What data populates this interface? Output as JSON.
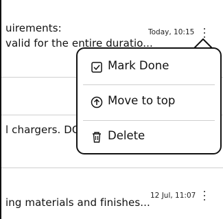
{
  "rows": [
    {
      "line1": "uirements:",
      "line2": "valid for the entire duratio...",
      "time": "Today, 10:15"
    },
    {
      "line1": "",
      "line2": "",
      "time": ""
    },
    {
      "line1": "",
      "line2": "l chargers. DON",
      "time": ""
    },
    {
      "line1": "",
      "line2": "",
      "time": ""
    },
    {
      "line1": "",
      "line2": "ing materials and finishes...",
      "time": "12 Jul, 11:07"
    }
  ],
  "menu": {
    "items": [
      {
        "label": "Mark Done",
        "icon": "checkbox-icon"
      },
      {
        "label": "Move to top",
        "icon": "circle-arrow-up-icon"
      },
      {
        "label": "Delete",
        "icon": "trash-icon"
      }
    ]
  }
}
